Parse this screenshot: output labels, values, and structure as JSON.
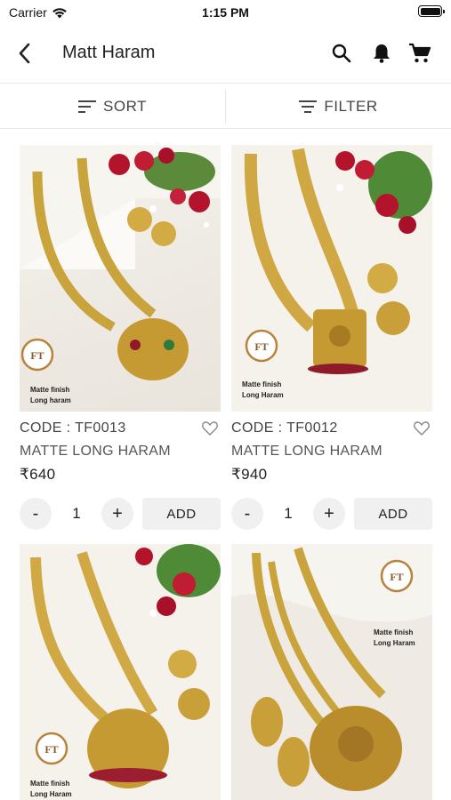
{
  "status_bar": {
    "carrier": "Carrier",
    "time": "1:15 PM"
  },
  "header": {
    "title": "Matt Haram"
  },
  "toolbar": {
    "sort_label": "SORT",
    "filter_label": "FILTER"
  },
  "products": [
    {
      "code": "CODE : TF0013",
      "name": "MATTE LONG HARAM",
      "price": "₹640",
      "qty": "1",
      "add_label": "ADD",
      "brand": "FT",
      "caption_1": "Matte finish",
      "caption_2": "Long haram"
    },
    {
      "code": "CODE : TF0012",
      "name": "MATTE LONG HARAM",
      "price": "₹940",
      "qty": "1",
      "add_label": "ADD",
      "brand": "FT",
      "caption_1": "Matte finish",
      "caption_2": "Long Haram"
    },
    {
      "brand": "FT",
      "caption_1": "Matte finish",
      "caption_2": "Long Haram"
    },
    {
      "brand": "FT",
      "caption_1": "Matte finish",
      "caption_2": "Long Haram"
    }
  ],
  "qty_controls": {
    "minus": "-",
    "plus": "+"
  },
  "colors": {
    "accent": "#222222",
    "gold": "#c9a33b",
    "ruby": "#b3142b",
    "control_bg": "#f0f0f0"
  },
  "icons": [
    "wifi-icon",
    "battery-icon",
    "back-arrow-icon",
    "search-icon",
    "bell-icon",
    "cart-icon",
    "sort-icon",
    "filter-icon",
    "heart-icon"
  ]
}
